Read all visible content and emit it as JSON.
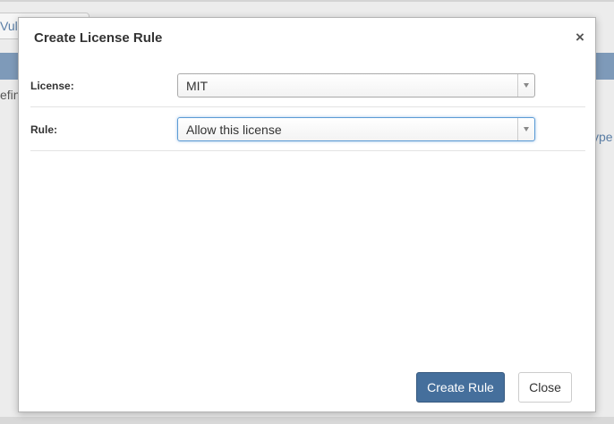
{
  "background": {
    "tab_label": "Vuln",
    "left_text": "efin",
    "right_text": "ype"
  },
  "modal": {
    "title": "Create License Rule",
    "close_icon": "×",
    "fields": [
      {
        "label": "License:",
        "value": "MIT"
      },
      {
        "label": "Rule:",
        "value": "Allow this license"
      }
    ],
    "buttons": {
      "primary": "Create Rule",
      "secondary": "Close"
    }
  },
  "colors": {
    "primary_button": "#456f9c",
    "header_bar": "#7e9ab9",
    "focus_ring": "#5b9bd5"
  }
}
